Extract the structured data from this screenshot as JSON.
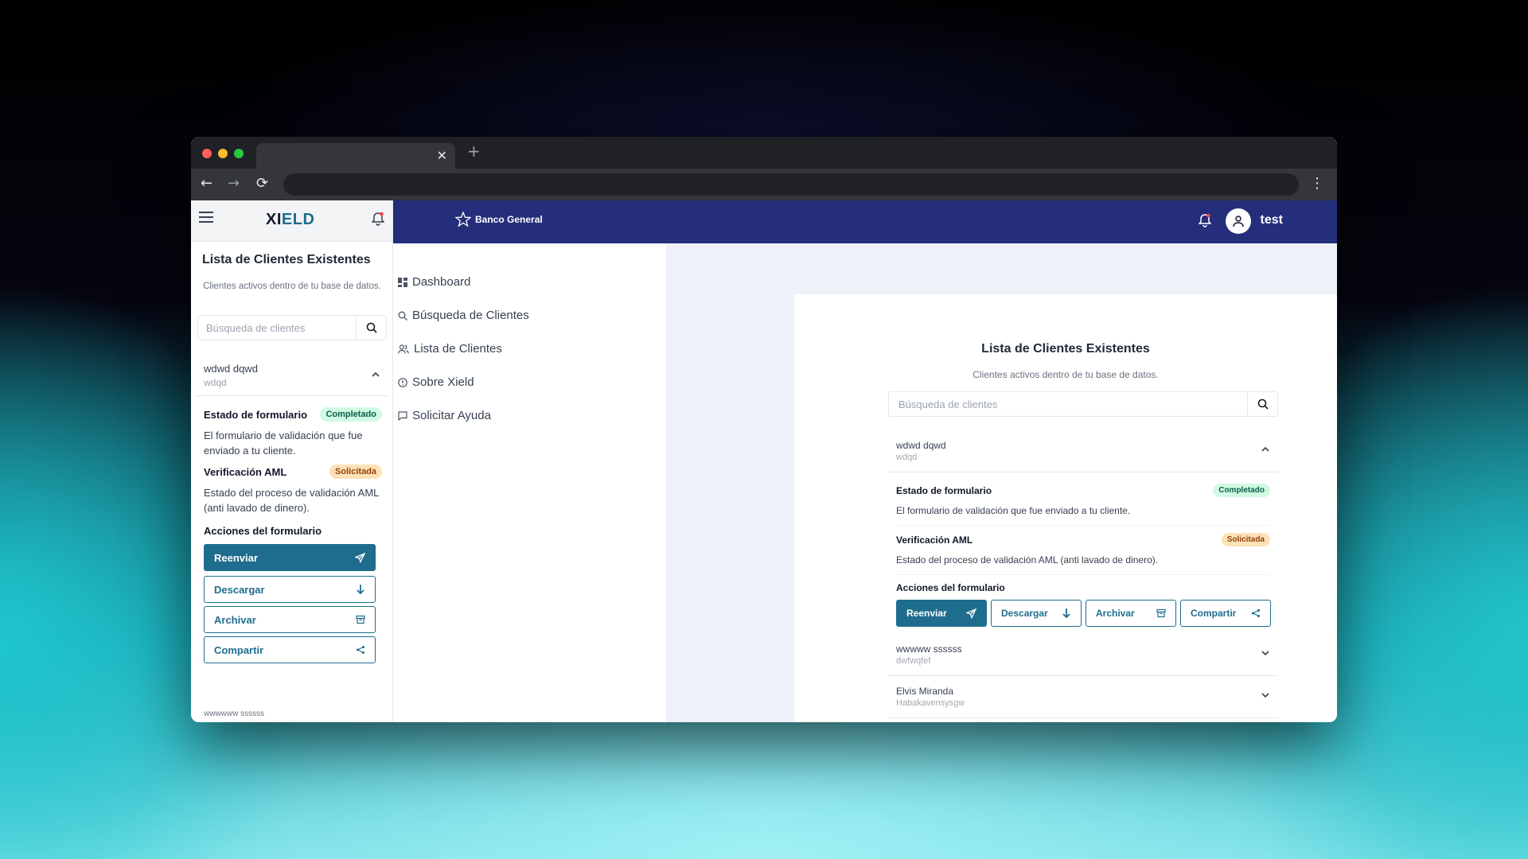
{
  "colors": {
    "primary": "#1e6d8e",
    "topbar": "#252e7b",
    "badge_ok_bg": "#d1fae5",
    "badge_warn_bg": "#fde2b8"
  },
  "browser": {
    "tab_close": "✕",
    "new_tab": "+",
    "back": "←",
    "forward": "→",
    "reload": "⟳",
    "menu": "⋮"
  },
  "mobile": {
    "logo_part1": "XI",
    "logo_part2": "ELD",
    "title": "Lista de Clientes Existentes",
    "subtitle": "Clientes activos dentro de tu base de datos.",
    "search_placeholder": "Búsqueda de clientes",
    "client": {
      "name": "wdwd dqwd",
      "sub": "wdqd"
    },
    "form_state_label": "Estado de formulario",
    "form_state_badge": "Completado",
    "form_state_text": "El formulario de validación que fue enviado a tu cliente.",
    "aml_label": "Verificación AML",
    "aml_badge": "Solicitada",
    "aml_text": "Estado del proceso de validación AML (anti lavado de dinero).",
    "actions_label": "Acciones del formulario",
    "buttons": [
      "Reenviar",
      "Descargar",
      "Archivar",
      "Compartir"
    ],
    "next_client_partial": "wwwwww ssssss"
  },
  "topbar": {
    "brand": "Banco General",
    "user": "test"
  },
  "sidebar": {
    "items": [
      {
        "label": "Dashboard",
        "icon": "grid-icon"
      },
      {
        "label": "Búsqueda de Clientes",
        "icon": "search-icon"
      },
      {
        "label": "Lista de Clientes",
        "icon": "users-icon"
      },
      {
        "label": "Sobre Xield",
        "icon": "info-icon"
      },
      {
        "label": "Solicitar Ayuda",
        "icon": "chat-icon"
      }
    ]
  },
  "main": {
    "title": "Lista de Clientes Existentes",
    "subtitle": "Clientes activos dentro de tu base de datos.",
    "search_placeholder": "Búsqueda de clientes",
    "clients": [
      {
        "name": "wdwd dqwd",
        "sub": "wdqd"
      },
      {
        "name": "wwwww ssssss",
        "sub": "dwfwqfef"
      },
      {
        "name": "Elvis Miranda",
        "sub": "Habakavensysgw"
      }
    ],
    "form_state_label": "Estado de formulario",
    "form_state_badge": "Completado",
    "form_state_text": "El formulario de validación que fue enviado a tu cliente.",
    "aml_label": "Verificación AML",
    "aml_badge": "Solicitada",
    "aml_text": "Estado del proceso de validación AML (anti lavado de dinero).",
    "actions_label": "Acciones del formulario",
    "buttons": [
      "Reenviar",
      "Descargar",
      "Archivar",
      "Compartir"
    ]
  }
}
